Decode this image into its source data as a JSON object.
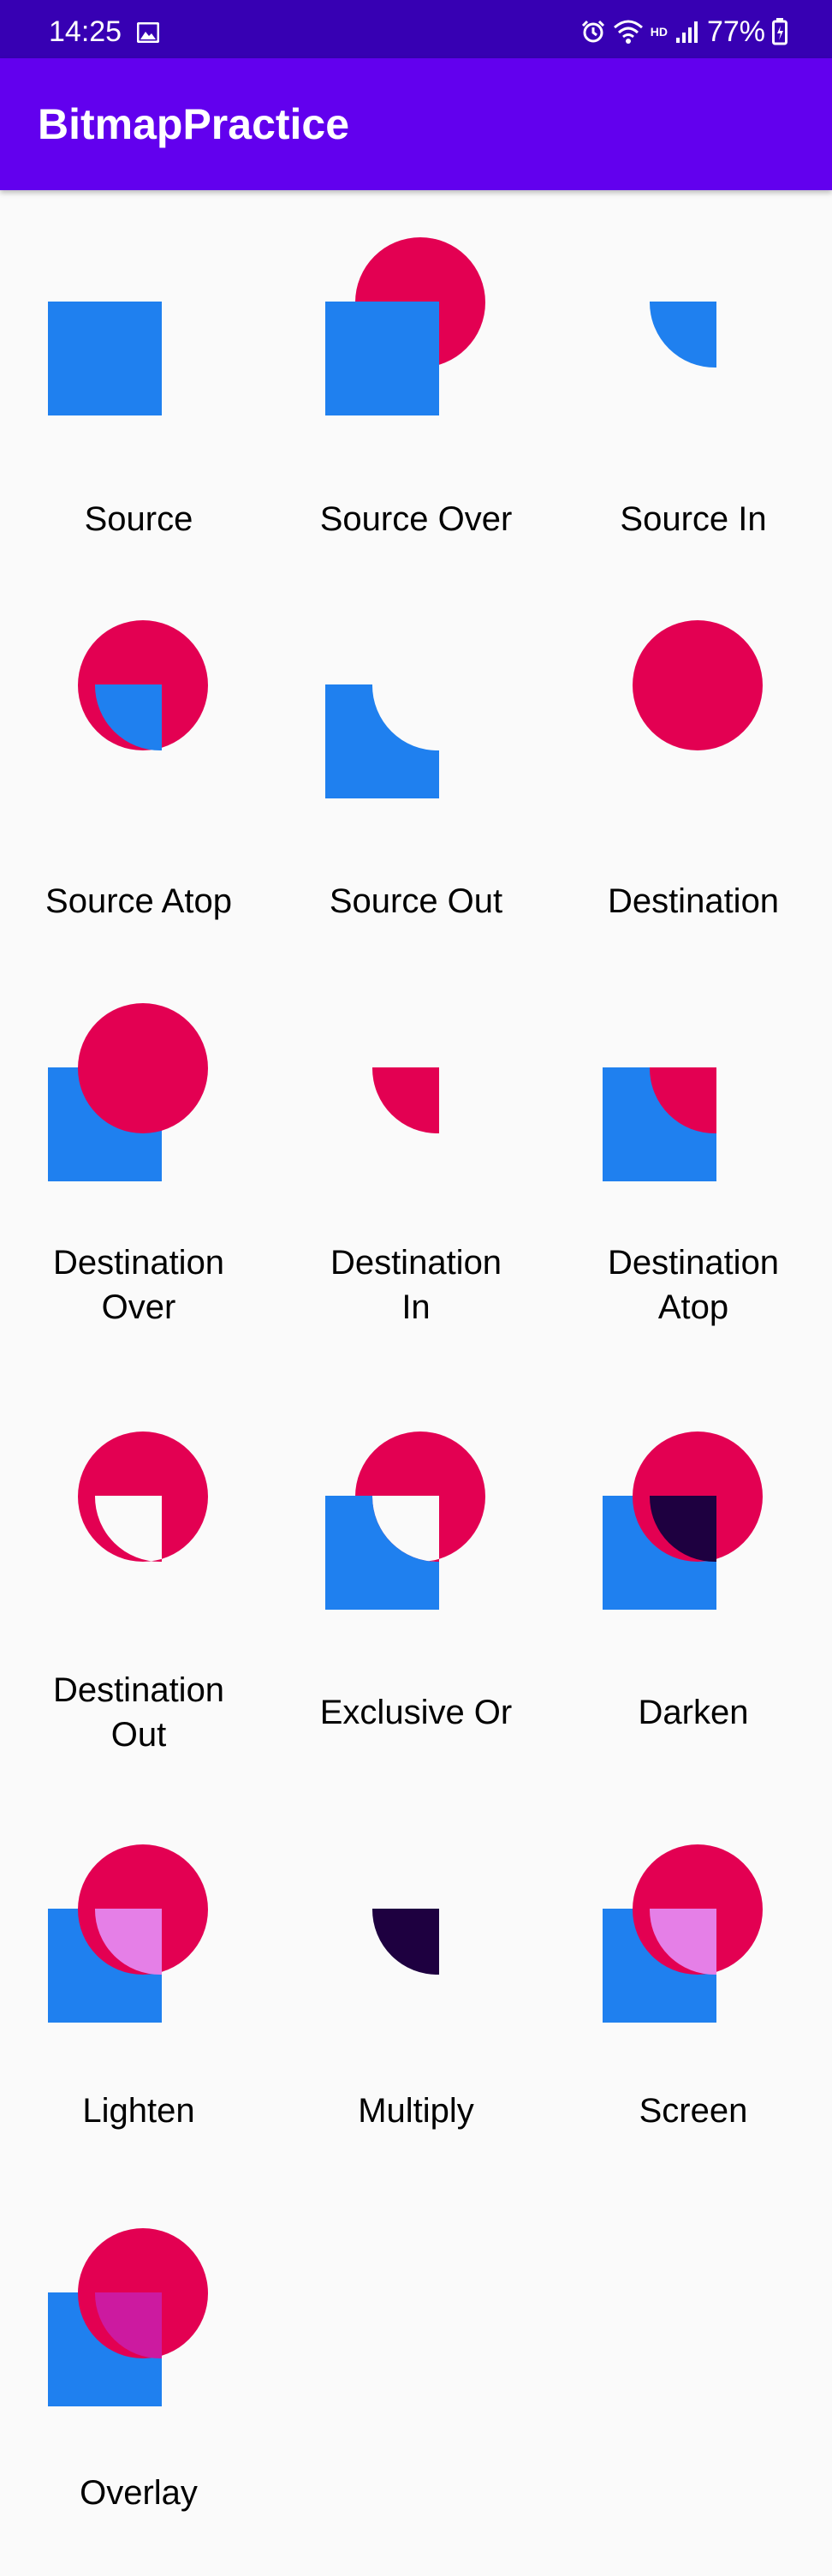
{
  "status_bar": {
    "time": "14:25",
    "battery_percent": "77%",
    "network_label": "HD",
    "icons": [
      "gallery-icon",
      "alarm-icon",
      "wifi-icon",
      "signal-icon",
      "battery-icon"
    ]
  },
  "app_bar": {
    "title": "BitmapPractice"
  },
  "colors": {
    "status_bar": "#3700b3",
    "app_bar": "#6200ee",
    "circle": "#e30052",
    "square": "#1f80ef",
    "dark_overlap": "#1e0040",
    "light_overlap": "#e57fe7",
    "overlay_overlap": "#cc1aa0"
  },
  "modes": [
    {
      "label": "Source",
      "mode": "source"
    },
    {
      "label": "Source Over",
      "mode": "source-over"
    },
    {
      "label": "Source In",
      "mode": "source-in"
    },
    {
      "label": "Source Atop",
      "mode": "source-atop"
    },
    {
      "label": "Source Out",
      "mode": "source-out"
    },
    {
      "label": "Destination",
      "mode": "destination"
    },
    {
      "label": "Destination Over",
      "mode": "destination-over"
    },
    {
      "label": "Destination In",
      "mode": "destination-in"
    },
    {
      "label": "Destination Atop",
      "mode": "destination-atop"
    },
    {
      "label": "Destination Out",
      "mode": "destination-out"
    },
    {
      "label": "Exclusive Or",
      "mode": "xor"
    },
    {
      "label": "Darken",
      "mode": "darken"
    },
    {
      "label": "Lighten",
      "mode": "lighten"
    },
    {
      "label": "Multiply",
      "mode": "multiply"
    },
    {
      "label": "Screen",
      "mode": "screen"
    },
    {
      "label": "Overlay",
      "mode": "overlay"
    }
  ]
}
